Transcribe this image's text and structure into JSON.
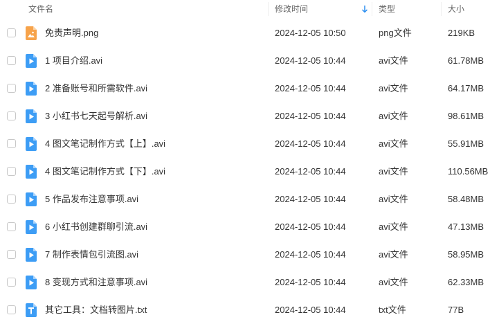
{
  "header": {
    "name": "文件名",
    "time": "修改时间",
    "type": "类型",
    "size": "大小"
  },
  "files": [
    {
      "icon": "image-file-icon",
      "name": "免责声明.png",
      "time": "2024-12-05 10:50",
      "type": "png文件",
      "size": "219KB"
    },
    {
      "icon": "video-file-icon",
      "name": "1 项目介绍.avi",
      "time": "2024-12-05 10:44",
      "type": "avi文件",
      "size": "61.78MB"
    },
    {
      "icon": "video-file-icon",
      "name": "2 准备账号和所需软件.avi",
      "time": "2024-12-05 10:44",
      "type": "avi文件",
      "size": "64.17MB"
    },
    {
      "icon": "video-file-icon",
      "name": "3 小红书七天起号解析.avi",
      "time": "2024-12-05 10:44",
      "type": "avi文件",
      "size": "98.61MB"
    },
    {
      "icon": "video-file-icon",
      "name": "4 图文笔记制作方式【上】.avi",
      "time": "2024-12-05 10:44",
      "type": "avi文件",
      "size": "55.91MB"
    },
    {
      "icon": "video-file-icon",
      "name": "4 图文笔记制作方式【下】.avi",
      "time": "2024-12-05 10:44",
      "type": "avi文件",
      "size": "110.56MB"
    },
    {
      "icon": "video-file-icon",
      "name": "5 作品发布注意事项.avi",
      "time": "2024-12-05 10:44",
      "type": "avi文件",
      "size": "58.48MB"
    },
    {
      "icon": "video-file-icon",
      "name": "6 小红书创建群聊引流.avi",
      "time": "2024-12-05 10:44",
      "type": "avi文件",
      "size": "47.13MB"
    },
    {
      "icon": "video-file-icon",
      "name": "7 制作表情包引流图.avi",
      "time": "2024-12-05 10:44",
      "type": "avi文件",
      "size": "58.95MB"
    },
    {
      "icon": "video-file-icon",
      "name": "8 变现方式和注意事项.avi",
      "time": "2024-12-05 10:44",
      "type": "avi文件",
      "size": "62.33MB"
    },
    {
      "icon": "text-file-icon",
      "name": "其它工具：文档转图片.txt",
      "time": "2024-12-05 10:44",
      "type": "txt文件",
      "size": "77B"
    }
  ],
  "colors": {
    "image_icon": "#f7a34a",
    "video_icon": "#3d9df5",
    "text_icon": "#3d9df5",
    "sort_arrow": "#2b8ef0"
  }
}
